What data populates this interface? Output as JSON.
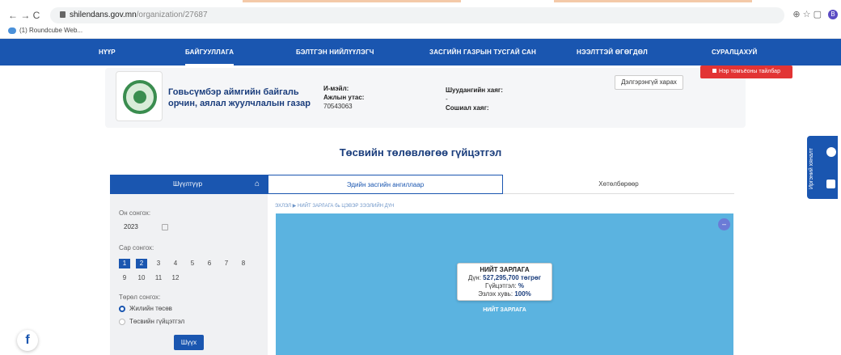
{
  "browser": {
    "nav_glyphs": "← → C",
    "url_host": "shilendans.gov.mn",
    "url_path": "/organization/27687",
    "bookmark": "(1) Roundcube Web...",
    "profile_letter": "B",
    "right_glyphs": "⊕ ☆ ▢"
  },
  "nav": {
    "items": [
      {
        "label": "НҮҮР"
      },
      {
        "label": "БАЙГУУЛЛАГА"
      },
      {
        "label": "БЭЛТГЭН НИЙЛҮҮЛЭГЧ"
      },
      {
        "label": "ЗАСГИЙН ГАЗРЫН ТУСГАЙ САН"
      },
      {
        "label": "НЭЭЛТТЭЙ ӨГӨГДӨЛ"
      },
      {
        "label": "СУРАЛЦАХУЙ"
      }
    ],
    "active_index": 1
  },
  "org": {
    "name": "Говьсүмбэр аймгийн байгаль орчин, аялал жуулчлалын газар",
    "email_label": "И-мэйл:",
    "phone_label": "Ажлын утас:",
    "phone_value": "70543063",
    "fax_label": "Шуудангийн хаяг:",
    "fax_value": "-",
    "social_label": "Сошиал хаяг:",
    "detail_button": "Дэлгэрэнгүй харах",
    "report_button": "Нэр томъёоны тайлбар"
  },
  "page_title": "Төсвийн төлөвлөгөө гүйцэтгэл",
  "filter": {
    "header": "Шүүлтүүр",
    "year_label": "Он сонгох:",
    "year_value": "2023",
    "month_label": "Сар сонгох:",
    "months": [
      "1",
      "2",
      "3",
      "4",
      "5",
      "6",
      "7",
      "8",
      "9",
      "10",
      "11",
      "12"
    ],
    "selected_months": [
      "1",
      "2"
    ],
    "type_label": "Төрөл сонгох:",
    "types": [
      "Жилийн төсөв",
      "Төсвийн гүйцэтгэл"
    ],
    "selected_type": "Жилийн төсөв",
    "search_button": "Шүүх"
  },
  "tabs": [
    {
      "label": "Эдийн засгийн ангиллаар",
      "active": true
    },
    {
      "label": "Хөтөлбөрөөр",
      "active": false
    }
  ],
  "breadcrumb": "ЭХЛЭЛ ▶ НИЙТ ЗАРЛАГА бь ЦЭВЭР ЗЭЭЛИЙН ДҮН",
  "treemap": {
    "color": "#5bb3e0",
    "node_label": "НИЙТ ЗАРЛАГА",
    "tooltip_title": "НИЙТ ЗАРЛАГА",
    "amount_label": "Дүн:",
    "amount_value": "527,295,700 төгрөг",
    "performance_label": "Гүйцэтгэл:",
    "performance_value": "%",
    "share_label": "Эзлэх хувь:",
    "share_value": "100%",
    "collapse_glyph": "–"
  },
  "feedback": {
    "label": "Иргэний хяналт"
  },
  "facebook": {
    "glyph": "f"
  },
  "colors": {
    "brand_blue": "#1a56b0",
    "title_navy": "#1a3d7c",
    "report_red": "#e23434"
  }
}
